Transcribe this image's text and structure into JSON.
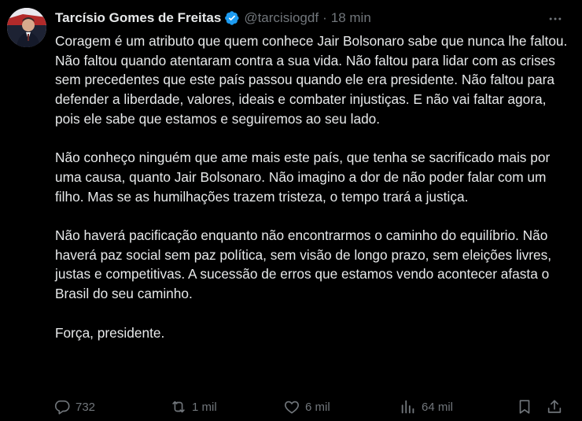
{
  "author": {
    "name": "Tarcísio Gomes de Freitas",
    "handle": "@tarcisiogdf",
    "separator": "·",
    "time": "18 min"
  },
  "tweet": {
    "paragraphs": [
      "Coragem é um atributo que quem conhece Jair Bolsonaro sabe que nunca lhe faltou. Não faltou quando atentaram contra a sua vida. Não faltou para lidar com as crises sem precedentes que este país passou quando ele era presidente. Não faltou para defender a liberdade, valores, ideais e combater injustiças. E não vai faltar agora, pois ele sabe que estamos e seguiremos ao seu lado.",
      "Não conheço ninguém que ame mais este país, que tenha se sacrificado mais por uma causa, quanto Jair Bolsonaro. Não imagino a dor de não poder falar com um filho. Mas se as humilhações trazem tristeza, o tempo trará a justiça.",
      "Não haverá pacificação enquanto não encontrarmos o caminho do equilíbrio. Não haverá paz social sem paz política, sem visão de longo prazo, sem eleições livres, justas e competitivas. A sucessão de erros que estamos vendo acontecer afasta o Brasil do seu caminho.",
      "Força, presidente."
    ]
  },
  "actions": {
    "replies": "732",
    "retweets": "1 mil",
    "likes": "6 mil",
    "views": "64 mil"
  },
  "icons": {
    "verified": "verified-badge-icon",
    "more": "more-icon",
    "reply": "reply-icon",
    "retweet": "retweet-icon",
    "like": "heart-icon",
    "views": "views-icon",
    "bookmark": "bookmark-icon",
    "share": "share-icon"
  },
  "colors": {
    "background": "#000000",
    "text": "#e7e9ea",
    "muted": "#71767b",
    "verified": "#1d9bf0"
  }
}
